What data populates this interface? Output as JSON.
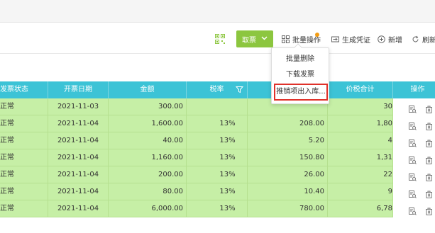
{
  "toolbar": {
    "fetch_label": "取票",
    "batch_label": "批量操作",
    "generate_label": "生成凭证",
    "add_label": "新增",
    "refresh_label": "刷新"
  },
  "dropdown": {
    "items": [
      {
        "label": "批量删除"
      },
      {
        "label": "下载发票"
      },
      {
        "label": "推销项出入库..."
      }
    ]
  },
  "table": {
    "headers": {
      "status": "发票状态",
      "date": "开票日期",
      "amount": "金额",
      "rate": "税率",
      "tax": "",
      "total": "价税合计",
      "ops": "操作"
    },
    "rows": [
      {
        "status": "正常",
        "date": "2021-11-03",
        "amount": "300.00",
        "rate": "",
        "tax": "",
        "total": "30"
      },
      {
        "status": "正常",
        "date": "2021-11-04",
        "amount": "1,600.00",
        "rate": "13%",
        "tax": "208.00",
        "total": "1,80"
      },
      {
        "status": "正常",
        "date": "2021-11-04",
        "amount": "40.00",
        "rate": "13%",
        "tax": "5.20",
        "total": "4"
      },
      {
        "status": "正常",
        "date": "2021-11-04",
        "amount": "1,160.00",
        "rate": "13%",
        "tax": "150.80",
        "total": "1,31"
      },
      {
        "status": "正常",
        "date": "2021-11-04",
        "amount": "200.00",
        "rate": "13%",
        "tax": "26.00",
        "total": "22"
      },
      {
        "status": "正常",
        "date": "2021-11-04",
        "amount": "80.00",
        "rate": "13%",
        "tax": "10.40",
        "total": "9"
      },
      {
        "status": "正常",
        "date": "2021-11-04",
        "amount": "6,000.00",
        "rate": "13%",
        "tax": "780.00",
        "total": "6,78"
      }
    ]
  },
  "colors": {
    "accent_green": "#8cc63f",
    "header_teal": "#3cc3d6",
    "row_green": "#c6efa6",
    "highlight_red": "#e0312a"
  },
  "icons": [
    "qr-code-icon",
    "chevron-down-icon",
    "batch-icon",
    "voucher-icon",
    "plus-circle-icon",
    "refresh-icon",
    "filter-icon",
    "view-icon",
    "trash-icon"
  ]
}
